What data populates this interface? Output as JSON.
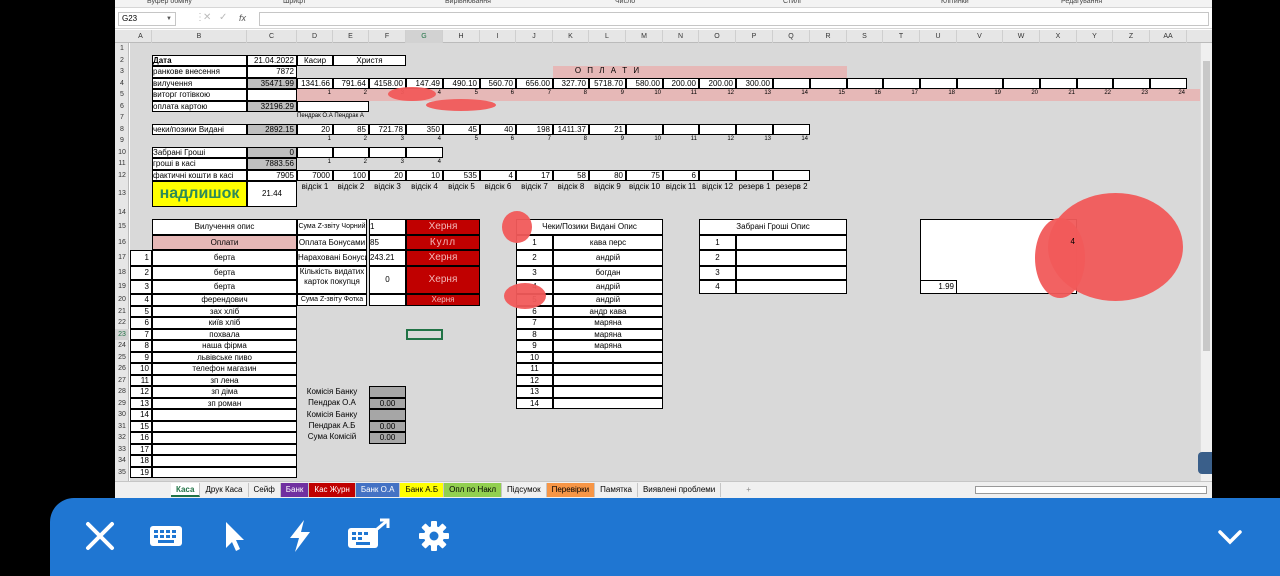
{
  "ribbon": [
    "Буфер обміну",
    "Шрифт",
    "Вирівнювання",
    "Число",
    "Стилі",
    "Клітинки",
    "Редагування"
  ],
  "namebox": "G23",
  "fx": "fx",
  "columns": [
    "A",
    "B",
    "C",
    "D",
    "E",
    "F",
    "G",
    "H",
    "I",
    "J",
    "K",
    "L",
    "M",
    "N",
    "O",
    "P",
    "Q",
    "R",
    "S",
    "T",
    "U",
    "V",
    "W",
    "X",
    "Y",
    "Z",
    "AA"
  ],
  "top": {
    "date_label": "Дата",
    "date": "21.04.2022",
    "cashier_label": "Касир",
    "cashier": "Христя",
    "morning_label": "ранкове внесення",
    "morning": "7872",
    "withdraw_label": "вилучення",
    "withdraw": "35471.99",
    "withdraw_vals": [
      "1341.66",
      "791.64",
      "4158.00",
      "147.49",
      "490.10",
      "560.70",
      "656.00",
      "327.70",
      "5718.70",
      "580.00",
      "200.00",
      "200.00",
      "300.00"
    ],
    "payments_title": "О П Л А Т И",
    "cash_rev_label": "виторг готівкою",
    "nums24": [
      "1",
      "2",
      "3",
      "4",
      "5",
      "6",
      "7",
      "8",
      "9",
      "10",
      "11",
      "12",
      "13",
      "14",
      "15",
      "16",
      "17",
      "18",
      "19",
      "20",
      "21",
      "22",
      "23",
      "24"
    ],
    "card_label": "оплата картою",
    "card": "32196.29",
    "pendrak": "Пендрак О.А Пендрак А",
    "checks_label": "чеки/позики Видані",
    "checks": "2892.15",
    "checks_vals": [
      "20",
      "85",
      "721.78",
      "350",
      "45",
      "40",
      "198",
      "1411.37",
      "21"
    ],
    "nums14": [
      "1",
      "2",
      "3",
      "4",
      "5",
      "6",
      "7",
      "8",
      "9",
      "10",
      "11",
      "12",
      "13",
      "14"
    ],
    "taken_label": "Забрані Гроші",
    "taken": "0",
    "incash_label": "гроші в касі",
    "incash": "7883.56",
    "nums4": [
      "1",
      "2",
      "3",
      "4"
    ],
    "actual_label": "фактичні кошти в касі",
    "actual": "7905",
    "actual_vals": [
      "7000",
      "100",
      "20",
      "10",
      "535",
      "4",
      "17",
      "58",
      "80",
      "75",
      "6"
    ],
    "depts": [
      "відсік 1",
      "відсік 2",
      "відсік 3",
      "відсік 4",
      "відсік 5",
      "відсік 6",
      "відсік 7",
      "відсік 8",
      "відсік 9",
      "відсік 10",
      "відсік 11",
      "відсік 12",
      "резерв 1",
      "резерв 2"
    ],
    "surplus_label": "надлишок",
    "surplus": "21.44"
  },
  "withdraw_desc": {
    "title": "Вилучення опис",
    "payments": "Оплати",
    "rows": [
      {
        "n": "1",
        "t": "берта"
      },
      {
        "n": "2",
        "t": "берта"
      },
      {
        "n": "3",
        "t": "берта"
      },
      {
        "n": "4",
        "t": "ферендович"
      },
      {
        "n": "5",
        "t": "зах хліб"
      },
      {
        "n": "6",
        "t": "київ хліб"
      },
      {
        "n": "7",
        "t": "похвала"
      },
      {
        "n": "8",
        "t": "наша фірма"
      },
      {
        "n": "9",
        "t": "львівське пиво"
      },
      {
        "n": "10",
        "t": "телефон магазин"
      },
      {
        "n": "11",
        "t": "зп лена"
      },
      {
        "n": "12",
        "t": "зп діма"
      },
      {
        "n": "13",
        "t": "зп роман"
      },
      {
        "n": "14",
        "t": ""
      },
      {
        "n": "15",
        "t": ""
      },
      {
        "n": "16",
        "t": ""
      },
      {
        "n": "17",
        "t": ""
      },
      {
        "n": "18",
        "t": ""
      },
      {
        "n": "19",
        "t": ""
      }
    ]
  },
  "zreport": {
    "z_black": "Сума Z-звіту Чорний",
    "z_black_v": "1",
    "bonus_pay": "Оплата Бонусами",
    "bonus_pay_v": "85",
    "bonus_acc": "Нараховані Бонуси",
    "bonus_acc_v": "243.21",
    "cards_issued": "Кількість видатих карток покупця",
    "cards_issued_v": "0",
    "z_photo": "Сума Z-звіту Фотка",
    "red1": "Херня",
    "red2": "Кулл",
    "red3": "Херня",
    "red4": "Херня",
    "red5": "Херня"
  },
  "commission": {
    "bank1": "Комісія Банку Пендрак О.А",
    "bank1_v": "0.00",
    "bank2": "Комісія Банку Пендрак А.Б",
    "bank2_v": "0.00",
    "total": "Сума Комісій",
    "total_v": "0.00"
  },
  "checks_desc": {
    "title": "Чеки/Позики Видані Опис",
    "rows": [
      {
        "n": "1",
        "t": "кава перс"
      },
      {
        "n": "2",
        "t": "андрій"
      },
      {
        "n": "3",
        "t": "богдан"
      },
      {
        "n": "4",
        "t": "андрій"
      },
      {
        "n": "5",
        "t": "андрій"
      },
      {
        "n": "6",
        "t": "андр кава"
      },
      {
        "n": "7",
        "t": "маряна"
      },
      {
        "n": "8",
        "t": "маряна"
      },
      {
        "n": "9",
        "t": "маряна"
      },
      {
        "n": "10",
        "t": ""
      },
      {
        "n": "11",
        "t": ""
      },
      {
        "n": "12",
        "t": ""
      },
      {
        "n": "13",
        "t": ""
      },
      {
        "n": "14",
        "t": ""
      }
    ]
  },
  "taken_desc": {
    "title": "Забрані Гроші Опис",
    "rows": [
      "1",
      "2",
      "3",
      "4"
    ]
  },
  "redacted_box": {
    "v1": "1.99",
    "v2": "4"
  },
  "tabs": [
    {
      "label": "Каса",
      "color": "#ffffff",
      "active": true
    },
    {
      "label": "Друк Каса",
      "color": "#f0f0f0"
    },
    {
      "label": "Сейф",
      "color": "#f0f0f0"
    },
    {
      "label": "Банк",
      "color": "#7030a0"
    },
    {
      "label": "Кас Журн",
      "color": "#c00000"
    },
    {
      "label": "Банк О.А",
      "color": "#4472c4"
    },
    {
      "label": "Банк А.Б",
      "color": "#ffff00"
    },
    {
      "label": "Опл по Накл",
      "color": "#92d050"
    },
    {
      "label": "Підсумок",
      "color": "#f0f0f0"
    },
    {
      "label": "Перевірки",
      "color": "#f79646"
    },
    {
      "label": "Памятка",
      "color": "#f0f0f0"
    },
    {
      "label": "Виявлені проблеми",
      "color": "#f0f0f0"
    }
  ]
}
